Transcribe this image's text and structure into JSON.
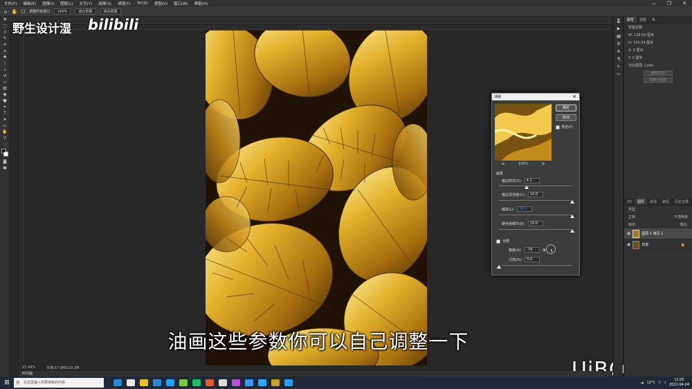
{
  "menu": [
    "文件(F)",
    "编辑(E)",
    "图像(I)",
    "图层(L)",
    "文字(Y)",
    "选择(S)",
    "滤镜(T)",
    "3D(D)",
    "视图(V)",
    "窗口(W)",
    "帮助(H)"
  ],
  "window_controls": [
    "—",
    "❐",
    "✕"
  ],
  "options_bar": {
    "checkbox_label": "调整所有窗口",
    "zoom": "100%",
    "fit_screen": "适合屏幕",
    "fill_screen": "填充屏幕"
  },
  "brand_text": "野生设计湿",
  "bili_logo": "bilibili",
  "subtitle": "油画这些参数你可以自己调整一下",
  "watermark": "UiBQ.CoM",
  "status": {
    "zoom": "21.44%",
    "doc": "文档:57.9M/103.3M"
  },
  "timeline_label": "时间轴",
  "dialog": {
    "title": "油画",
    "ok": "确定",
    "cancel": "取消",
    "preview_label": "预览(P)",
    "preview_zoom": "100%",
    "brush_header": "画笔",
    "params": [
      {
        "label": "描边样式(S):",
        "value": "4.1",
        "knob": 0.38
      },
      {
        "label": "描边清洁度(C):",
        "value": "10.0",
        "knob": 1.0
      },
      {
        "label": "缩放(L):",
        "value": "10.0",
        "knob": 1.0
      },
      {
        "label": "硬毛刷细节(B):",
        "value": "10.0",
        "knob": 1.0
      }
    ],
    "lighting_header": "光照",
    "angle_label": "角度(A):",
    "angle_value": "-74",
    "angle_unit": "度",
    "shine_label": "闪亮(H):",
    "shine_value": "0.0",
    "shine_knob": 0.0
  },
  "right_panel": {
    "tabs_top": [
      "属性",
      "调整",
      "库"
    ],
    "smart_filter": "智能滤镜",
    "w": "W: 128.69 厘米",
    "h": "H: 193.04 厘米",
    "x": "X: 0 厘米",
    "y": "Y: 0 厘米",
    "no_layers": "对应图层: Color",
    "edit_btn": "编辑内容",
    "convert_btn": "转换为图层",
    "tabs_layers": [
      "3D",
      "图层",
      "通道",
      "路径",
      "历史记录"
    ],
    "kind": "类型",
    "blend": "正常",
    "opacity": "不透明度",
    "lock": "锁定:",
    "fill": "填充:",
    "layers": [
      {
        "name": "图层 1 拷贝 1",
        "selected": true
      },
      {
        "name": "背景",
        "selected": false
      }
    ]
  },
  "taskbar": {
    "search_placeholder": "在这里输入你要搜索的内容",
    "weather": "12°C",
    "time": "11:05",
    "date": "2022-04-04",
    "icon_colors": [
      "#2b88d8",
      "#e8e8e8",
      "#f0c020",
      "#2b88d8",
      "#20a0ff",
      "#7ac943",
      "#1fbf60",
      "#e45c2a",
      "#dddddd",
      "#b44fd7",
      "#3399ff",
      "#2fa6ff",
      "#c9a02a",
      "#23a0ff"
    ]
  }
}
